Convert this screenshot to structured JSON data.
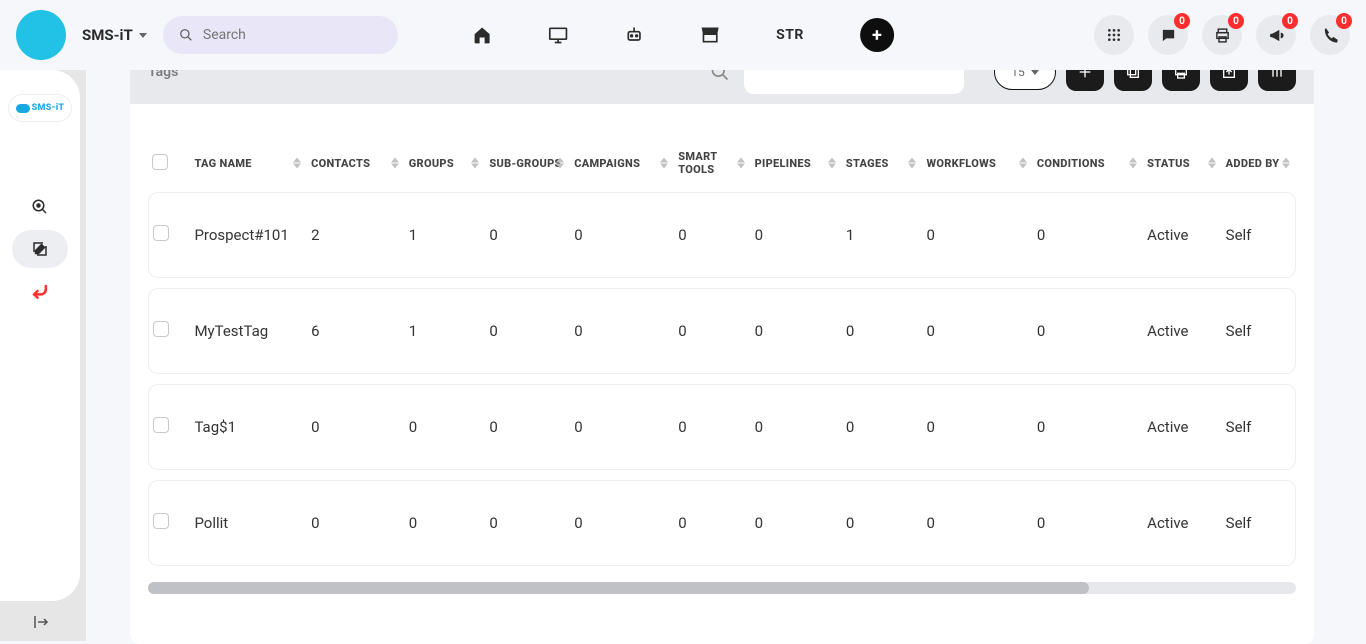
{
  "brand": "SMS-iT",
  "search_placeholder": "Search",
  "center_nav": {
    "str_label": "STR"
  },
  "badges": {
    "chat": "0",
    "print": "0",
    "announce": "0",
    "phone": "0"
  },
  "section_title": "Tags",
  "page_size": "15",
  "columns": {
    "tag_name": "TAG NAME",
    "contacts": "CONTACTS",
    "groups": "GROUPS",
    "sub_groups": "SUB-GROUPS",
    "campaigns": "CAMPAIGNS",
    "smart_tools": "SMART TOOLS",
    "pipelines": "PIPELINES",
    "stages": "STAGES",
    "workflows": "WORKFLOWS",
    "conditions": "CONDITIONS",
    "status": "STATUS",
    "added_by": "ADDED BY"
  },
  "rows": [
    {
      "tag_name": "Prospect#101",
      "contacts": "2",
      "groups": "1",
      "sub_groups": "0",
      "campaigns": "0",
      "smart_tools": "0",
      "pipelines": "0",
      "stages": "1",
      "workflows": "0",
      "conditions": "0",
      "status": "Active",
      "added_by": "Self"
    },
    {
      "tag_name": "MyTestTag",
      "contacts": "6",
      "groups": "1",
      "sub_groups": "0",
      "campaigns": "0",
      "smart_tools": "0",
      "pipelines": "0",
      "stages": "0",
      "workflows": "0",
      "conditions": "0",
      "status": "Active",
      "added_by": "Self"
    },
    {
      "tag_name": "Tag$1",
      "contacts": "0",
      "groups": "0",
      "sub_groups": "0",
      "campaigns": "0",
      "smart_tools": "0",
      "pipelines": "0",
      "stages": "0",
      "workflows": "0",
      "conditions": "0",
      "status": "Active",
      "added_by": "Self"
    },
    {
      "tag_name": "Pollit",
      "contacts": "0",
      "groups": "0",
      "sub_groups": "0",
      "campaigns": "0",
      "smart_tools": "0",
      "pipelines": "0",
      "stages": "0",
      "workflows": "0",
      "conditions": "0",
      "status": "Active",
      "added_by": "Self"
    }
  ]
}
